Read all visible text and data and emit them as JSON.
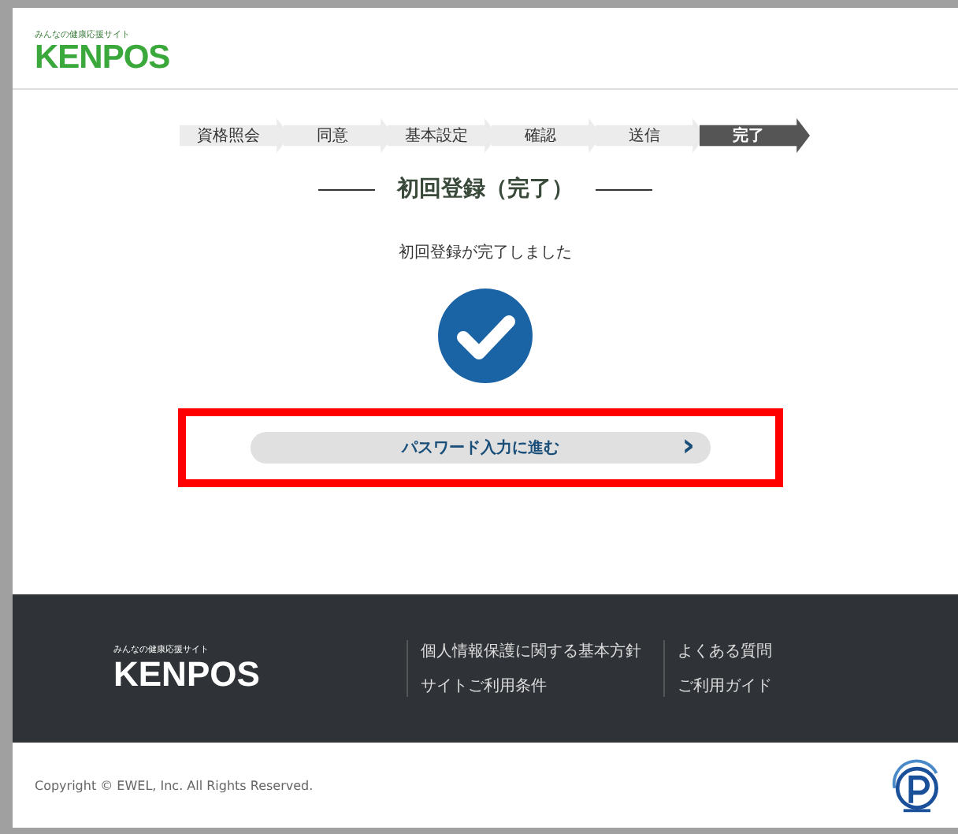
{
  "header": {
    "tagline": "みんなの健康応援サイト",
    "logo": "KENPOS"
  },
  "steps": [
    {
      "label": "資格照会",
      "selected": false
    },
    {
      "label": "同意",
      "selected": false
    },
    {
      "label": "基本設定",
      "selected": false
    },
    {
      "label": "確認",
      "selected": false
    },
    {
      "label": "送信",
      "selected": false
    },
    {
      "label": "完了",
      "selected": true
    }
  ],
  "title": "初回登録（完了）",
  "message": "初回登録が完了しました",
  "next_button": {
    "label": "パスワード入力に進む",
    "icon": "›"
  },
  "footer": {
    "tagline": "みんなの健康応援サイト",
    "logo": "KENPOS",
    "link_columns": [
      [
        "個人情報保護に関する基本方針",
        "サイトご利用条件"
      ],
      [
        "よくある質問",
        "ご利用ガイド"
      ]
    ],
    "copyright": "Copyright © EWEL, Inc. All Rights Reserved."
  }
}
